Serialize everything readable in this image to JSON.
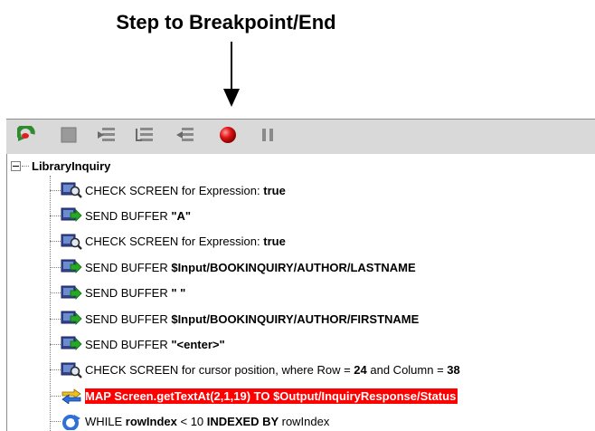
{
  "callout": {
    "title": "Step to Breakpoint/End"
  },
  "toolbar": {
    "buttons": [
      {
        "name": "run-icon"
      },
      {
        "name": "stop-icon"
      },
      {
        "name": "step-into-icon"
      },
      {
        "name": "step-over-icon"
      },
      {
        "name": "step-out-icon"
      },
      {
        "name": "step-to-breakpoint-icon"
      },
      {
        "name": "pause-icon"
      }
    ]
  },
  "tree": {
    "root": "LibraryInquiry",
    "rows": [
      {
        "icon": "check-screen-icon",
        "parts": [
          "CHECK SCREEN for Expression: ",
          "true"
        ]
      },
      {
        "icon": "send-buffer-icon",
        "parts": [
          "SEND BUFFER ",
          "\"A\""
        ]
      },
      {
        "icon": "check-screen-icon",
        "parts": [
          "CHECK SCREEN for Expression: ",
          "true"
        ]
      },
      {
        "icon": "send-buffer-icon",
        "parts": [
          "SEND BUFFER ",
          "$Input/BOOKINQUIRY/AUTHOR/LASTNAME"
        ]
      },
      {
        "icon": "send-buffer-icon",
        "parts": [
          "SEND BUFFER ",
          "\" \""
        ]
      },
      {
        "icon": "send-buffer-icon",
        "parts": [
          "SEND BUFFER ",
          "$Input/BOOKINQUIRY/AUTHOR/FIRSTNAME"
        ]
      },
      {
        "icon": "send-buffer-icon",
        "parts": [
          "SEND BUFFER ",
          "\"<enter>\""
        ]
      },
      {
        "icon": "check-screen-icon",
        "parts": [
          "CHECK SCREEN for cursor position, where Row = ",
          "24",
          " and Column = ",
          "38"
        ]
      },
      {
        "icon": "map-icon",
        "parts": [
          "MAP Screen.getTextAt(2,1,19) TO $Output/InquiryResponse/Status"
        ],
        "selected": true
      },
      {
        "icon": "while-loop-icon",
        "parts": [
          "WHILE ",
          "rowIndex",
          " < 10",
          " INDEXED BY ",
          "rowIndex"
        ]
      }
    ]
  }
}
